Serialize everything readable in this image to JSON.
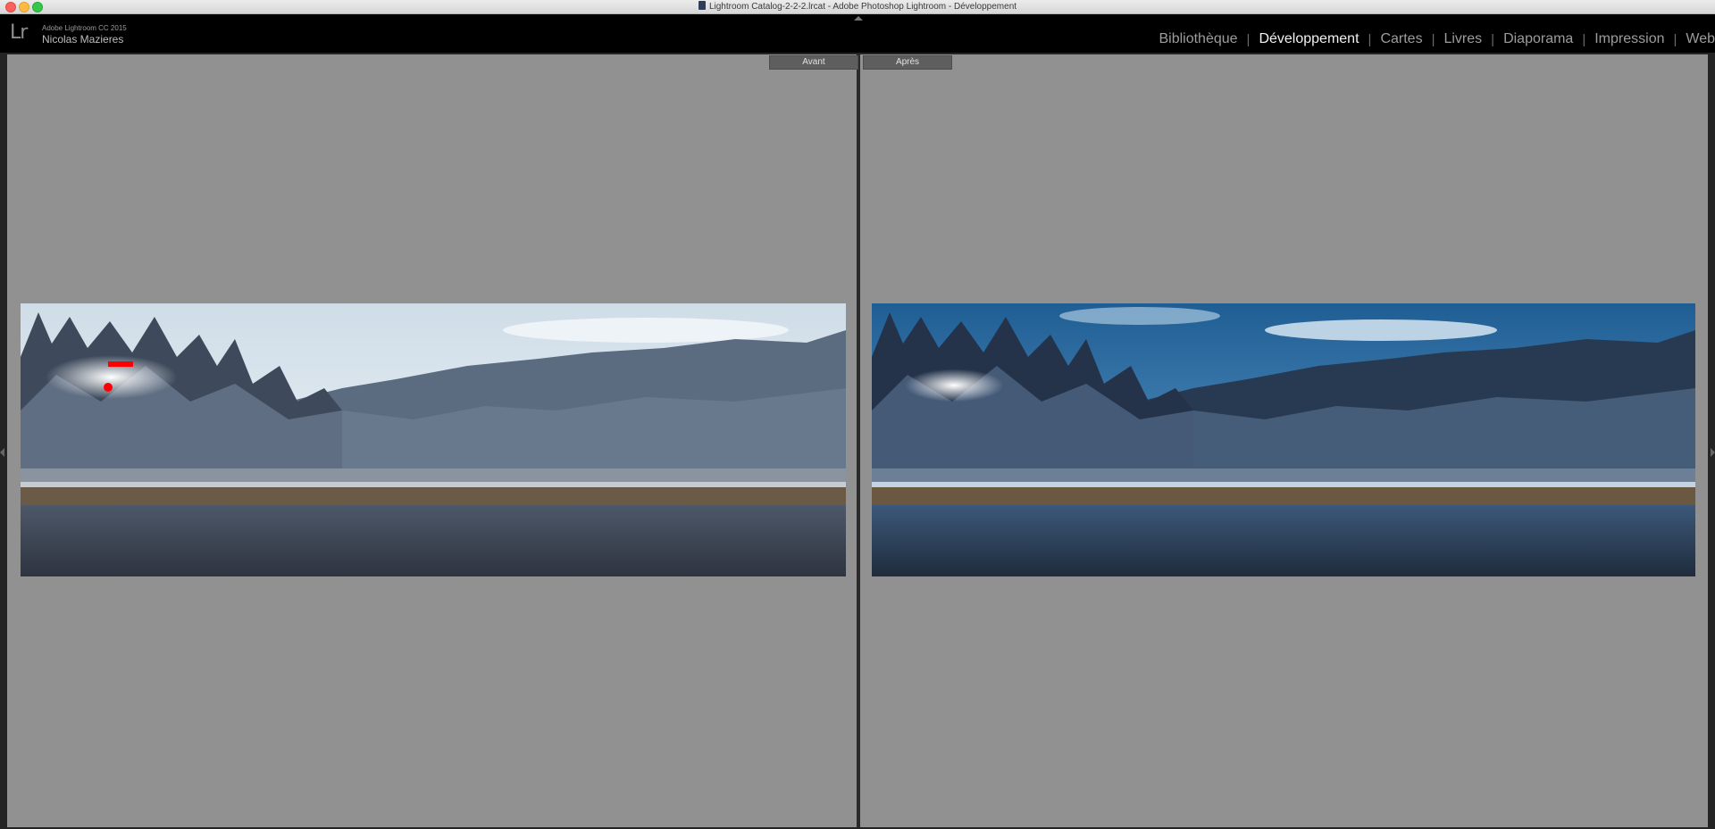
{
  "window": {
    "title": "Lightroom  Catalog-2-2-2.lrcat - Adobe Photoshop Lightroom - Développement"
  },
  "identity": {
    "logo": "Lr",
    "product": "Adobe Lightroom CC 2015",
    "user": "Nicolas Mazieres"
  },
  "modules": [
    {
      "label": "Bibliothèque",
      "active": false
    },
    {
      "label": "Développement",
      "active": true
    },
    {
      "label": "Cartes",
      "active": false
    },
    {
      "label": "Livres",
      "active": false
    },
    {
      "label": "Diaporama",
      "active": false
    },
    {
      "label": "Impression",
      "active": false
    },
    {
      "label": "Web",
      "active": false
    }
  ],
  "module_separator": "|",
  "compare": {
    "before_label": "Avant",
    "after_label": "Après"
  },
  "colors": {
    "active_module": "#f1f1f1",
    "inactive_module": "#9c9c9c",
    "canvas": "#919191",
    "clipping_highlight": "#ff0000"
  }
}
